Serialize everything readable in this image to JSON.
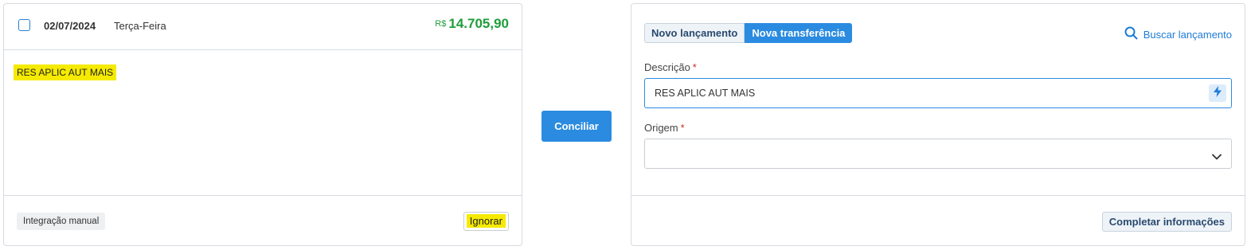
{
  "transaction": {
    "date": "02/07/2024",
    "weekday": "Terça-Feira",
    "currency": "R$",
    "amount": "14.705,90",
    "description": "RES APLIC AUT MAIS",
    "integration_tag": "Integração manual",
    "ignore_label": "Ignorar"
  },
  "action": {
    "conciliar_label": "Conciliar"
  },
  "form": {
    "tabs": [
      {
        "label": "Novo lançamento",
        "active": false
      },
      {
        "label": "Nova transferência",
        "active": true
      }
    ],
    "search_label": "Buscar lançamento",
    "description_label": "Descrição",
    "description_value": "RES APLIC AUT MAIS",
    "origin_label": "Origem",
    "origin_value": "",
    "required_mark": "*",
    "complete_label": "Completar informações"
  },
  "colors": {
    "primary": "#2b8be0",
    "amount_positive": "#1f9d3a",
    "highlight": "#f5ea00",
    "required": "#d02b2b"
  },
  "icons": {
    "search": "search-icon",
    "bolt": "bolt-icon",
    "chevron": "chevron-down-icon"
  }
}
